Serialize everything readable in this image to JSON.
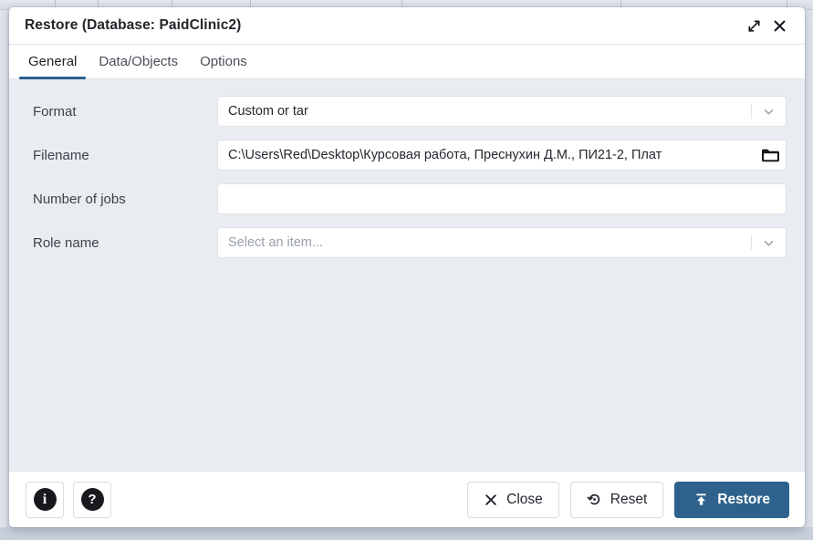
{
  "window": {
    "title": "Restore (Database: PaidClinic2)",
    "maximize_icon": "expand-diagonal-icon",
    "close_icon": "close-icon"
  },
  "tabs": [
    {
      "label": "General",
      "active": true
    },
    {
      "label": "Data/Objects",
      "active": false
    },
    {
      "label": "Options",
      "active": false
    }
  ],
  "form": {
    "fields": [
      {
        "label": "Format",
        "type": "select",
        "value": "Custom or tar",
        "placeholder": "",
        "is_placeholder": false
      },
      {
        "label": "Filename",
        "type": "file",
        "value": "C:\\Users\\Red\\Desktop\\Курсовая работа, Преснухин Д.М., ПИ21-2, Плат",
        "placeholder": "",
        "is_placeholder": false
      },
      {
        "label": "Number of jobs",
        "type": "text",
        "value": "",
        "placeholder": "",
        "is_placeholder": false
      },
      {
        "label": "Role name",
        "type": "select",
        "value": "Select an item...",
        "placeholder": "Select an item...",
        "is_placeholder": true
      }
    ]
  },
  "footer": {
    "info_label": "i",
    "help_label": "?",
    "close_label": "Close",
    "reset_label": "Reset",
    "restore_label": "Restore"
  },
  "colors": {
    "accent": "#2e628c",
    "tab_underline": "#2a628f",
    "form_bg": "#e9ecf1",
    "dialog_bg": "#ffffff"
  }
}
